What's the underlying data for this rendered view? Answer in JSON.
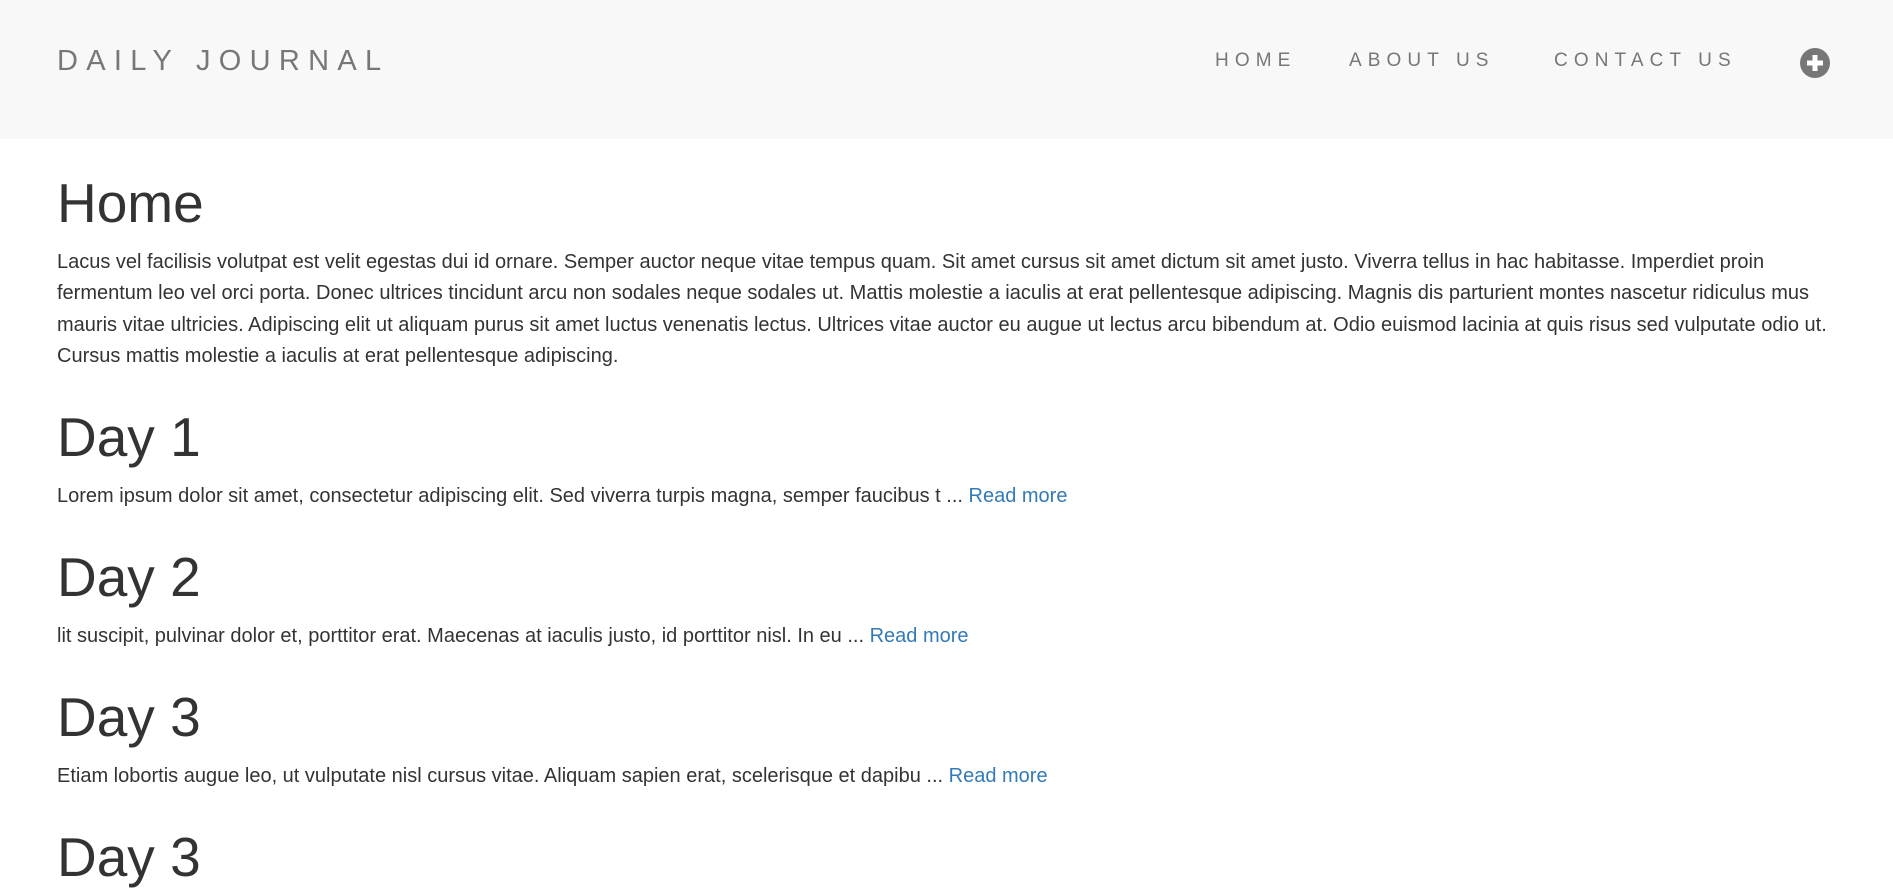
{
  "navbar": {
    "brand": "DAILY JOURNAL",
    "links": [
      "HOME",
      "ABOUT US",
      "CONTACT US"
    ],
    "compose_icon": "plus-circle-icon"
  },
  "colors": {
    "navbar_bg": "#f8f8f8",
    "nav_text": "#777777",
    "body_text": "#333333",
    "link": "#337ab7"
  },
  "home": {
    "title": "Home",
    "text": "Lacus vel facilisis volutpat est velit egestas dui id ornare. Semper auctor neque vitae tempus quam. Sit amet cursus sit amet dictum sit amet justo. Viverra tellus in hac habitasse. Imperdiet proin fermentum leo vel orci porta. Donec ultrices tincidunt arcu non sodales neque sodales ut. Mattis molestie a iaculis at erat pellentesque adipiscing. Magnis dis parturient montes nascetur ridiculus mus mauris vitae ultricies. Adipiscing elit ut aliquam purus sit amet luctus venenatis lectus. Ultrices vitae auctor eu augue ut lectus arcu bibendum at. Odio euismod lacinia at quis risus sed vulputate odio ut. Cursus mattis molestie a iaculis at erat pellentesque adipiscing."
  },
  "posts": [
    {
      "title": "Day 1",
      "excerpt": "Lorem ipsum dolor sit amet, consectetur adipiscing elit. Sed viverra turpis magna, semper faucibus t ... ",
      "read_more": "Read more"
    },
    {
      "title": "Day 2",
      "excerpt": "lit suscipit, pulvinar dolor et, porttitor erat. Maecenas at iaculis justo, id porttitor nisl. In eu ... ",
      "read_more": "Read more"
    },
    {
      "title": "Day 3",
      "excerpt": "Etiam lobortis augue leo, ut vulputate nisl cursus vitae. Aliquam sapien erat, scelerisque et dapibu ... ",
      "read_more": "Read more"
    },
    {
      "title": "Day 3"
    }
  ]
}
